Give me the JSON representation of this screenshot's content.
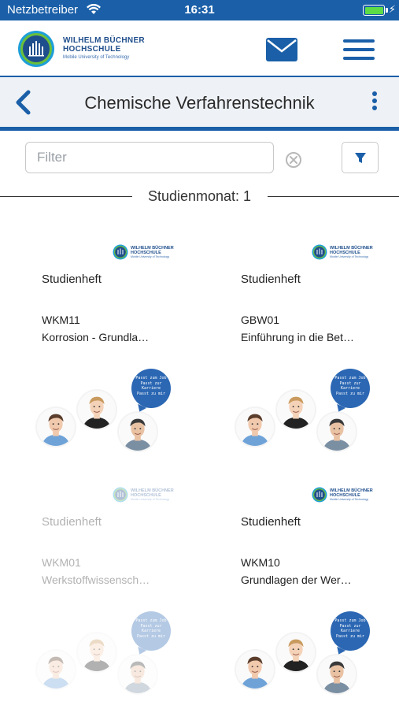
{
  "status_bar": {
    "carrier": "Netzbetreiber",
    "time": "16:31",
    "battery_level": 1.0
  },
  "header": {
    "logo": {
      "line1": "WILHELM BÜCHNER",
      "line2": "HOCHSCHULE",
      "line3": "Mobile University of Technology"
    },
    "mail_icon": "mail-icon",
    "menu_icon": "hamburger-menu-icon"
  },
  "title_bar": {
    "title": "Chemische Verfahrenstechnik",
    "back_icon": "chevron-left-icon",
    "more_icon": "vertical-dots-icon"
  },
  "filter": {
    "placeholder": "Filter",
    "value": "",
    "clear_icon": "clear-circle-icon",
    "filter_icon": "funnel-icon"
  },
  "section": {
    "label": "Studienmonat: 1"
  },
  "card_bubble": {
    "line1": "Passt zum Job",
    "line2": "Passt zur Karriere",
    "line3": "Passt zu mir"
  },
  "cards": [
    {
      "type": "Studienheft",
      "code": "WKM11",
      "title": "Korrosion - Grundla…",
      "enabled": true
    },
    {
      "type": "Studienheft",
      "code": "GBW01",
      "title": "Einführung in die Bet…",
      "enabled": true
    },
    {
      "type": "Studienheft",
      "code": "WKM01",
      "title": "Werkstoffwissensch…",
      "enabled": false
    },
    {
      "type": "Studienheft",
      "code": "WKM10",
      "title": "Grundlagen der Wer…",
      "enabled": true
    }
  ],
  "colors": {
    "brand_blue": "#1a5fa8",
    "bubble_blue": "#2b67b3",
    "title_bar_bg": "#eef1f5"
  }
}
